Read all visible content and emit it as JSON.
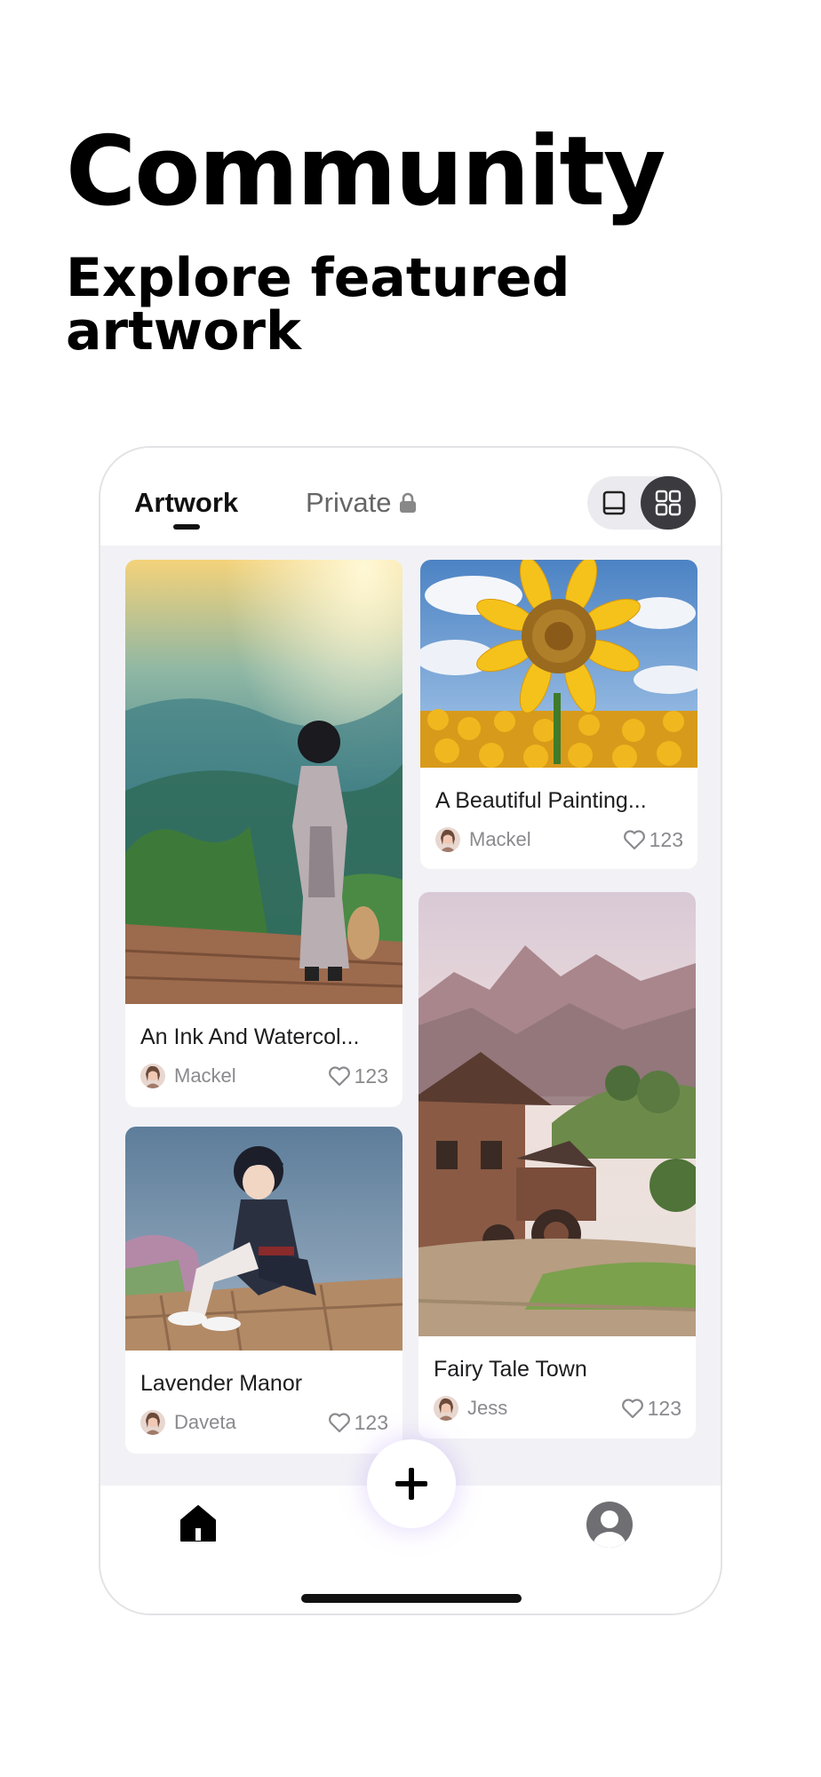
{
  "hero": {
    "title": "Community",
    "subtitle": "Explore featured artwork"
  },
  "tabs": {
    "artwork": "Artwork",
    "private": "Private"
  },
  "cards": [
    {
      "title": "An Ink And Watercol...",
      "author": "Mackel",
      "likes": "123"
    },
    {
      "title": "A Beautiful Painting...",
      "author": "Mackel",
      "likes": "123"
    },
    {
      "title": "Lavender Manor",
      "author": "Daveta",
      "likes": "123"
    },
    {
      "title": "Fairy Tale Town",
      "author": "Jess",
      "likes": "123"
    }
  ],
  "nav": {
    "icons": [
      "home-icon",
      "plus-icon",
      "profile-icon"
    ]
  },
  "colors": {
    "background": "#ffffff",
    "feed_background": "#f2f2f6",
    "toggle_active": "#3a3a3f",
    "text_primary": "#1d1d1f",
    "text_secondary": "#8a8a8e"
  }
}
